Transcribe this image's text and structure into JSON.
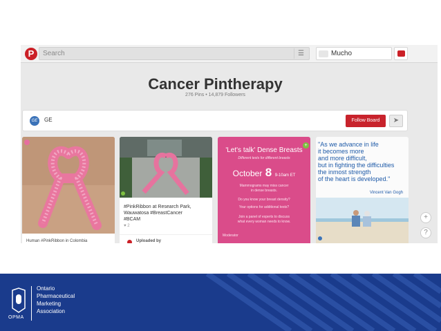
{
  "header": {
    "search_placeholder": "Search",
    "username": "Mucho"
  },
  "board": {
    "title": "Cancer Pintherapy",
    "stats": "276 Pins  •  14,879 Followers",
    "owner": "GE",
    "follow_label": "Follow Board"
  },
  "pins": [
    {
      "caption": "Human #PinkRibbon in Colombia"
    },
    {
      "caption_lines": [
        "#PinkRibbon at Research Park,",
        "Wauwatosa #BreastCancer",
        "#BCAM"
      ],
      "likes": "♥ 2",
      "uploaded_by": "Uploaded by"
    },
    {
      "heading": "'Let's talk' Dense Breasts",
      "subheading": "Different tests for different breasts",
      "month": "October",
      "day": "8",
      "time": "9-10am ET",
      "line1": "Mammograms may miss cancer",
      "line1b": "in dense breasts.",
      "line2": "Do you know your breast density?",
      "line3": "Your options for additional tests?",
      "line4": "Join a panel of experts to discuss",
      "line4b": "what every woman needs to know.",
      "moderator": "Moderator"
    },
    {
      "quote_lines": [
        "\"As we advance in life",
        "it becomes more",
        "and more difficult,",
        "but in fighting the difficulties",
        "the inmost strength",
        "of the heart is developed.\""
      ],
      "author": "Vincent Van Gogh"
    }
  ],
  "footer": {
    "abbr": "OPMA",
    "org_lines": [
      "Ontario",
      "Pharmaceutical",
      "Marketing",
      "Association"
    ]
  },
  "colors": {
    "pinterest_red": "#cb2027",
    "footer_blue": "#1a3b8c",
    "pink_card": "#da4c8a",
    "quote_blue": "#1e5aa8"
  },
  "icons": [
    "pinterest-logo-icon",
    "menu-icon",
    "notification-icon",
    "ge-logo-icon",
    "send-icon",
    "plus-icon",
    "help-icon",
    "opma-logo-icon"
  ]
}
